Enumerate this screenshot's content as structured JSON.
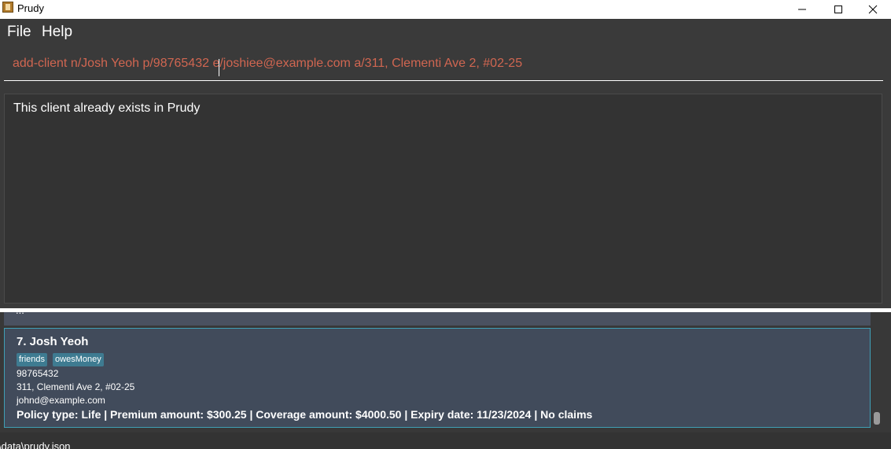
{
  "window": {
    "title": "Prudy",
    "icons": {
      "app": "prudy-app-icon",
      "minimize": "minimize-icon",
      "maximize": "maximize-icon",
      "close": "close-icon"
    }
  },
  "menu": {
    "file_label": "File",
    "help_label": "Help"
  },
  "command": {
    "value": "add-client n/Josh Yeoh p/98765432 e/joshiee@example.com a/311, Clementi Ave 2, #02-25"
  },
  "result": {
    "message": "This client already exists in Prudy"
  },
  "client": {
    "name": "7. Josh Yeoh",
    "tags": [
      "friends",
      "owesMoney"
    ],
    "phone": "98765432",
    "address": "311, Clementi Ave 2, #02-25",
    "email": "johnd@example.com",
    "policy": "Policy type: Life | Premium amount: $300.25 | Coverage amount: $4000.50 | Expiry date: 11/23/2024 | No claims"
  },
  "status": {
    "path": "\\data\\prudy.json"
  },
  "colors": {
    "command_text": "#d06651",
    "card_bg": "#414b5b",
    "card_border": "#3f9fb5",
    "tag_bg": "#3e7b91"
  }
}
